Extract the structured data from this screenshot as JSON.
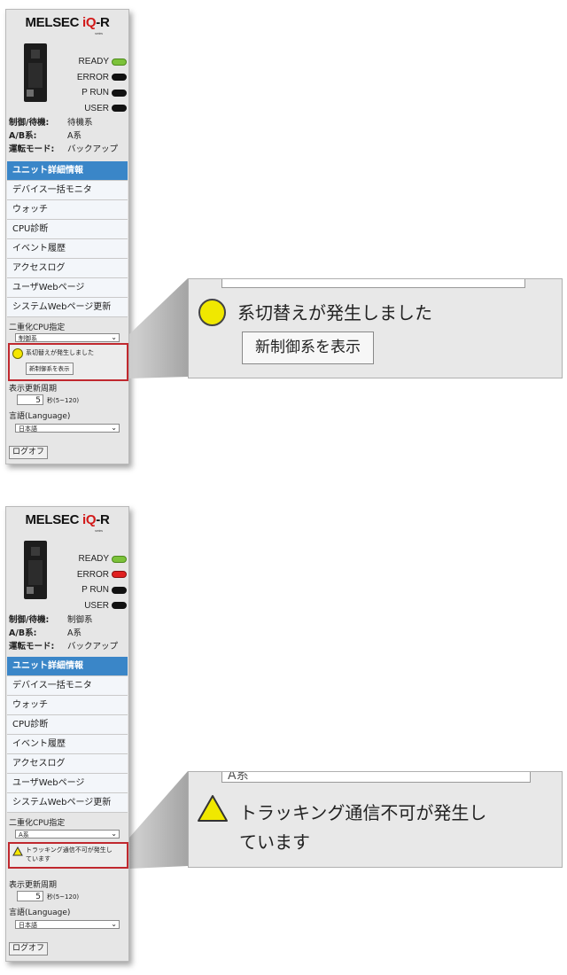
{
  "logo": {
    "brand": "MELSEC",
    "iq": "iQ",
    "r": "-R",
    "series": "series"
  },
  "leds": [
    {
      "label": "READY",
      "state": "green"
    },
    {
      "label": "ERROR",
      "state": "off"
    },
    {
      "label": "P RUN",
      "state": "off"
    },
    {
      "label": "USER",
      "state": "off"
    }
  ],
  "leds2": [
    {
      "label": "READY",
      "state": "green"
    },
    {
      "label": "ERROR",
      "state": "red"
    },
    {
      "label": "P RUN",
      "state": "off"
    },
    {
      "label": "USER",
      "state": "off"
    }
  ],
  "panel1": {
    "ctrl_key": "制御/待機:",
    "ctrl_val": "待機系",
    "ab_key": "A/B系:",
    "ab_val": "A系",
    "mode_key": "運転モード:",
    "mode_val": "バックアップ",
    "cpu_label": "二重化CPU指定",
    "cpu_select": "制御系",
    "alarm_text": "系切替えが発生しました",
    "alarm_button": "新制御系を表示"
  },
  "panel2": {
    "ctrl_key": "制御/待機:",
    "ctrl_val": "制御系",
    "ab_key": "A/B系:",
    "ab_val": "A系",
    "mode_key": "運転モード:",
    "mode_val": "バックアップ",
    "cpu_label": "二重化CPU指定",
    "cpu_select": "A系",
    "alarm_text_1": "トラッキング通信不可が発生し",
    "alarm_text_2": "ています"
  },
  "menu": [
    "ユニット詳細情報",
    "デバイス一括モニタ",
    "ウォッチ",
    "CPU診断",
    "イベント履歴",
    "アクセスログ",
    "ユーザWebページ",
    "システムWebページ更新"
  ],
  "refresh": {
    "label": "表示更新周期",
    "value": "5",
    "unit": "秒(5~120)"
  },
  "language": {
    "label": "言語(Language)",
    "value": "日本語"
  },
  "logoff": "ログオフ",
  "zoom1": {
    "text": "系切替えが発生しました",
    "button": "新制御系を表示"
  },
  "zoom2": {
    "field": "A系",
    "line1": "トラッキング通信不可が発生し",
    "line2": "ています"
  },
  "colors": {
    "accent": "#3a86c8",
    "alarm_border": "#c0282e",
    "warning_yellow": "#f0e800",
    "led_green": "#7cc23a",
    "led_red": "#e02020"
  }
}
